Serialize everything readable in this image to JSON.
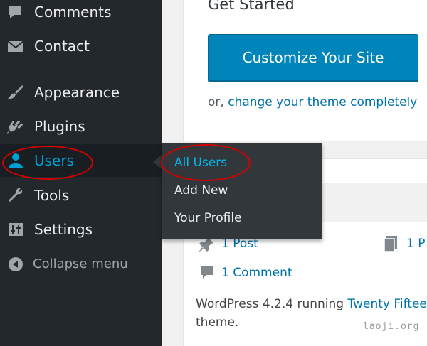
{
  "sidebar": {
    "items": [
      {
        "label": "Comments",
        "icon": "comment-bubble-icon"
      },
      {
        "label": "Contact",
        "icon": "envelope-icon"
      },
      {
        "label": "Appearance",
        "icon": "paintbrush-icon"
      },
      {
        "label": "Plugins",
        "icon": "plug-icon"
      },
      {
        "label": "Users",
        "icon": "user-icon"
      },
      {
        "label": "Tools",
        "icon": "wrench-icon"
      },
      {
        "label": "Settings",
        "icon": "sliders-icon"
      }
    ],
    "collapse_label": "Collapse menu",
    "active_color": "#00a0d2",
    "background": "#23282d"
  },
  "flyout": {
    "items": [
      {
        "label": "All Users",
        "current": true
      },
      {
        "label": "Add New"
      },
      {
        "label": "Your Profile"
      }
    ]
  },
  "main": {
    "get_started_title": "Get Started",
    "customize_button": "Customize Your Site",
    "or_prefix": "or,",
    "change_theme_link": "change your theme completely",
    "glance": {
      "posts": "1 Post",
      "pages": "1 P",
      "comments": "1 Comment"
    },
    "footer": {
      "prefix": "WordPress 4.2.4 running",
      "theme_link": "Twenty Fiftee",
      "suffix": "theme."
    }
  },
  "annotation_color": "#d40000",
  "watermark": "laoji.org"
}
